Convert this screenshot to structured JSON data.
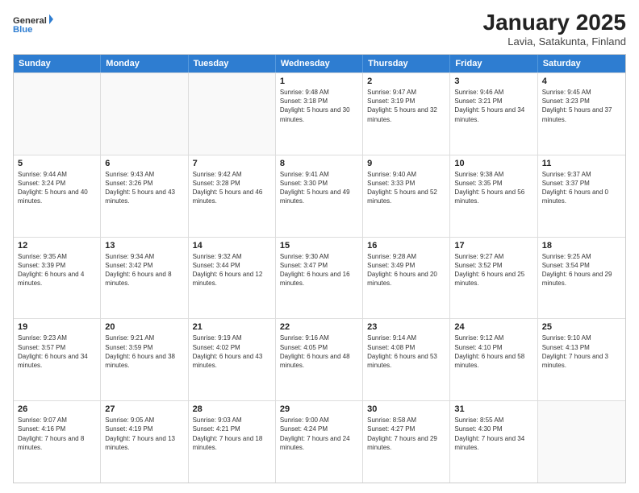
{
  "header": {
    "logo_line1": "General",
    "logo_line2": "Blue",
    "title": "January 2025",
    "subtitle": "Lavia, Satakunta, Finland"
  },
  "days_of_week": [
    "Sunday",
    "Monday",
    "Tuesday",
    "Wednesday",
    "Thursday",
    "Friday",
    "Saturday"
  ],
  "weeks": [
    [
      {
        "day": "",
        "info": "",
        "empty": true
      },
      {
        "day": "",
        "info": "",
        "empty": true
      },
      {
        "day": "",
        "info": "",
        "empty": true
      },
      {
        "day": "1",
        "info": "Sunrise: 9:48 AM\nSunset: 3:18 PM\nDaylight: 5 hours and 30 minutes.",
        "empty": false
      },
      {
        "day": "2",
        "info": "Sunrise: 9:47 AM\nSunset: 3:19 PM\nDaylight: 5 hours and 32 minutes.",
        "empty": false
      },
      {
        "day": "3",
        "info": "Sunrise: 9:46 AM\nSunset: 3:21 PM\nDaylight: 5 hours and 34 minutes.",
        "empty": false
      },
      {
        "day": "4",
        "info": "Sunrise: 9:45 AM\nSunset: 3:23 PM\nDaylight: 5 hours and 37 minutes.",
        "empty": false
      }
    ],
    [
      {
        "day": "5",
        "info": "Sunrise: 9:44 AM\nSunset: 3:24 PM\nDaylight: 5 hours and 40 minutes.",
        "empty": false
      },
      {
        "day": "6",
        "info": "Sunrise: 9:43 AM\nSunset: 3:26 PM\nDaylight: 5 hours and 43 minutes.",
        "empty": false
      },
      {
        "day": "7",
        "info": "Sunrise: 9:42 AM\nSunset: 3:28 PM\nDaylight: 5 hours and 46 minutes.",
        "empty": false
      },
      {
        "day": "8",
        "info": "Sunrise: 9:41 AM\nSunset: 3:30 PM\nDaylight: 5 hours and 49 minutes.",
        "empty": false
      },
      {
        "day": "9",
        "info": "Sunrise: 9:40 AM\nSunset: 3:33 PM\nDaylight: 5 hours and 52 minutes.",
        "empty": false
      },
      {
        "day": "10",
        "info": "Sunrise: 9:38 AM\nSunset: 3:35 PM\nDaylight: 5 hours and 56 minutes.",
        "empty": false
      },
      {
        "day": "11",
        "info": "Sunrise: 9:37 AM\nSunset: 3:37 PM\nDaylight: 6 hours and 0 minutes.",
        "empty": false
      }
    ],
    [
      {
        "day": "12",
        "info": "Sunrise: 9:35 AM\nSunset: 3:39 PM\nDaylight: 6 hours and 4 minutes.",
        "empty": false
      },
      {
        "day": "13",
        "info": "Sunrise: 9:34 AM\nSunset: 3:42 PM\nDaylight: 6 hours and 8 minutes.",
        "empty": false
      },
      {
        "day": "14",
        "info": "Sunrise: 9:32 AM\nSunset: 3:44 PM\nDaylight: 6 hours and 12 minutes.",
        "empty": false
      },
      {
        "day": "15",
        "info": "Sunrise: 9:30 AM\nSunset: 3:47 PM\nDaylight: 6 hours and 16 minutes.",
        "empty": false
      },
      {
        "day": "16",
        "info": "Sunrise: 9:28 AM\nSunset: 3:49 PM\nDaylight: 6 hours and 20 minutes.",
        "empty": false
      },
      {
        "day": "17",
        "info": "Sunrise: 9:27 AM\nSunset: 3:52 PM\nDaylight: 6 hours and 25 minutes.",
        "empty": false
      },
      {
        "day": "18",
        "info": "Sunrise: 9:25 AM\nSunset: 3:54 PM\nDaylight: 6 hours and 29 minutes.",
        "empty": false
      }
    ],
    [
      {
        "day": "19",
        "info": "Sunrise: 9:23 AM\nSunset: 3:57 PM\nDaylight: 6 hours and 34 minutes.",
        "empty": false
      },
      {
        "day": "20",
        "info": "Sunrise: 9:21 AM\nSunset: 3:59 PM\nDaylight: 6 hours and 38 minutes.",
        "empty": false
      },
      {
        "day": "21",
        "info": "Sunrise: 9:19 AM\nSunset: 4:02 PM\nDaylight: 6 hours and 43 minutes.",
        "empty": false
      },
      {
        "day": "22",
        "info": "Sunrise: 9:16 AM\nSunset: 4:05 PM\nDaylight: 6 hours and 48 minutes.",
        "empty": false
      },
      {
        "day": "23",
        "info": "Sunrise: 9:14 AM\nSunset: 4:08 PM\nDaylight: 6 hours and 53 minutes.",
        "empty": false
      },
      {
        "day": "24",
        "info": "Sunrise: 9:12 AM\nSunset: 4:10 PM\nDaylight: 6 hours and 58 minutes.",
        "empty": false
      },
      {
        "day": "25",
        "info": "Sunrise: 9:10 AM\nSunset: 4:13 PM\nDaylight: 7 hours and 3 minutes.",
        "empty": false
      }
    ],
    [
      {
        "day": "26",
        "info": "Sunrise: 9:07 AM\nSunset: 4:16 PM\nDaylight: 7 hours and 8 minutes.",
        "empty": false
      },
      {
        "day": "27",
        "info": "Sunrise: 9:05 AM\nSunset: 4:19 PM\nDaylight: 7 hours and 13 minutes.",
        "empty": false
      },
      {
        "day": "28",
        "info": "Sunrise: 9:03 AM\nSunset: 4:21 PM\nDaylight: 7 hours and 18 minutes.",
        "empty": false
      },
      {
        "day": "29",
        "info": "Sunrise: 9:00 AM\nSunset: 4:24 PM\nDaylight: 7 hours and 24 minutes.",
        "empty": false
      },
      {
        "day": "30",
        "info": "Sunrise: 8:58 AM\nSunset: 4:27 PM\nDaylight: 7 hours and 29 minutes.",
        "empty": false
      },
      {
        "day": "31",
        "info": "Sunrise: 8:55 AM\nSunset: 4:30 PM\nDaylight: 7 hours and 34 minutes.",
        "empty": false
      },
      {
        "day": "",
        "info": "",
        "empty": true
      }
    ]
  ]
}
